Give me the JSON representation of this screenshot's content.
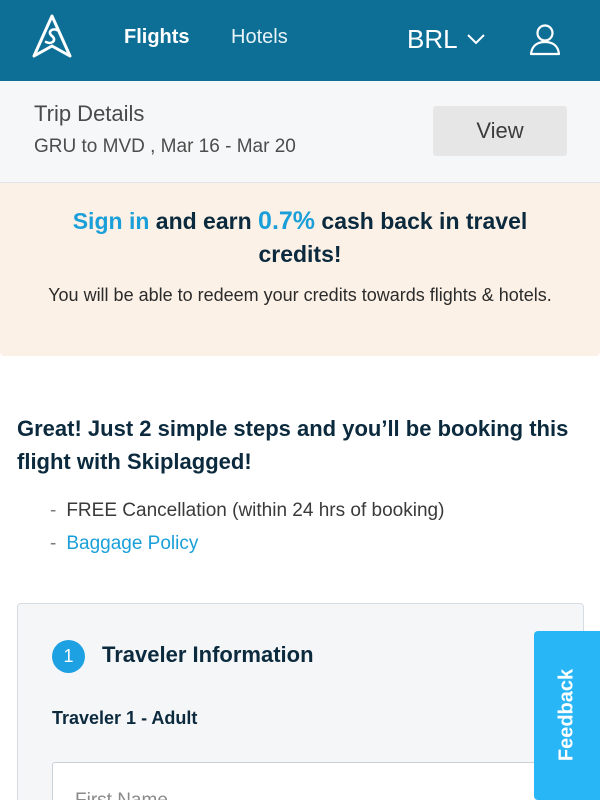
{
  "nav": {
    "flights_label": "Flights",
    "hotels_label": "Hotels",
    "currency": "BRL",
    "brand_color": "#0e6f96"
  },
  "trip": {
    "title": "Trip Details",
    "summary": "GRU to MVD , Mar 16 - Mar 20",
    "view_label": "View"
  },
  "promo": {
    "sign_in_link": "Sign in",
    "text_1": " and earn ",
    "percent": "0.7%",
    "text_2": " cash back in travel credits!",
    "subtext": "You will be able to redeem your credits towards flights & hotels.",
    "background": "#fcf1e6",
    "accent": "#1a9fd9"
  },
  "intro": {
    "heading": "Great! Just 2 simple steps and you’ll be booking this flight with Skiplagged!",
    "bullets": [
      {
        "text": "FREE Cancellation (within 24 hrs of booking)"
      },
      {
        "text": "Baggage Policy"
      }
    ]
  },
  "traveler": {
    "step_number": "1",
    "title": "Traveler Information",
    "traveler_label": "Traveler 1 - Adult",
    "first_name_placeholder": "First Name"
  },
  "feedback_label": "Feedback",
  "icons": {
    "logo": "skiplagged-logo-icon",
    "currency_caret": "chevron-down-icon",
    "account": "user-icon"
  }
}
